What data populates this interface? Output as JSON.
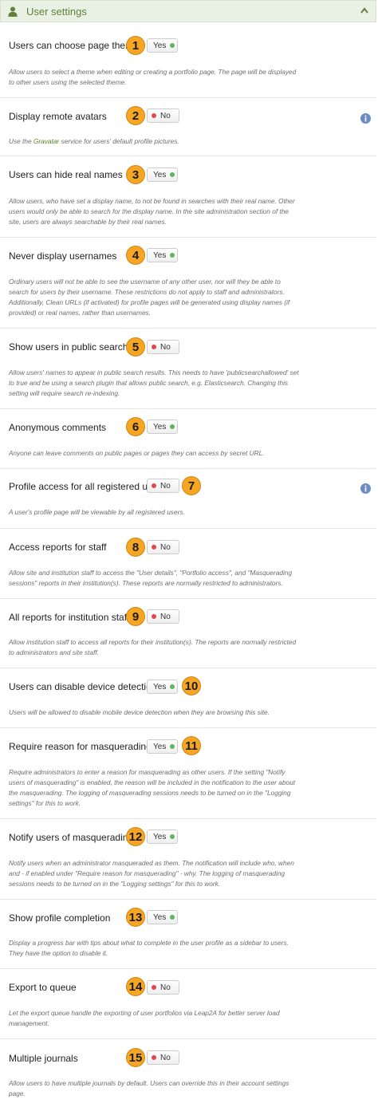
{
  "panel": {
    "title": "User settings",
    "icon": "user-icon",
    "collapse_icon": "chevron-up-icon",
    "colors": {
      "header_bg": "#e9f0e4",
      "title": "#62803a",
      "badge": "#f6a623",
      "on_dot": "#5fb55f",
      "off_dot": "#e2474f",
      "info": "#6d8cc5"
    }
  },
  "settings": [
    {
      "label": "Users can choose page themes",
      "value": "Yes",
      "badge": "1",
      "desc": [
        "Allow users to select a theme when editing or creating a portfolio page. The page will be displayed",
        "to other users using the selected theme."
      ]
    },
    {
      "label": "Display remote avatars",
      "value": "No",
      "badge": "2",
      "info_icon": "info-icon",
      "desc_before": "Use the ",
      "desc_link": "Gravatar",
      "desc_after": " service for users' default profile pictures."
    },
    {
      "label": "Users can hide real names",
      "value": "Yes",
      "badge": "3",
      "desc": [
        "Allow users, who have set a display name, to not be found in searches with their real name. Other",
        "users would only be able to search for the display name. In the site administration section of the",
        "site, users are always searchable by their real names."
      ]
    },
    {
      "label": "Never display usernames",
      "value": "Yes",
      "badge": "4",
      "desc": [
        "Ordinary users will not be able to see the username of any other user, nor will they be able to",
        "search for users by their username. These restrictions do not apply to staff and administrators.",
        "Additionally, Clean URLs (if activated) for profile pages will be generated using display names (if",
        "provided) or real names, rather than usernames."
      ]
    },
    {
      "label": "Show users in public search",
      "value": "No",
      "badge": "5",
      "desc": [
        "Allow users' names to appear in public search results. This needs to have 'publicsearchallowed' set",
        "to true and be using a search plugin that allows public search, e.g. Elasticsearch. Changing this",
        "setting will require search re-indexing."
      ]
    },
    {
      "label": "Anonymous comments",
      "value": "Yes",
      "badge": "6",
      "desc": [
        "Anyone can leave comments on public pages or pages they can access by secret URL."
      ]
    },
    {
      "label": "Profile access for all registered users",
      "value": "No",
      "badge": "7",
      "info_icon": "info-icon",
      "desc": [
        "A user's profile page will be viewable by all registered users."
      ]
    },
    {
      "label": "Access reports for staff",
      "value": "No",
      "badge": "8",
      "desc": [
        "Allow site and institution staff to access the \"User details\", \"Portfolio access\", and \"Masquerading",
        "sessions\" reports in their institution(s). These reports are normally restricted to administrators."
      ]
    },
    {
      "label": "All reports for institution staff",
      "value": "No",
      "badge": "9",
      "desc": [
        "Allow institution staff to access all reports for their institution(s). The reports are normally restricted",
        "to administrators and site staff."
      ]
    },
    {
      "label": "Users can disable device detection",
      "value": "Yes",
      "badge": "10",
      "desc": [
        "Users will be allowed to disable mobile device detection when they are browsing this site."
      ]
    },
    {
      "label": "Require reason for masquerading",
      "value": "Yes",
      "badge": "11",
      "desc": [
        "Require administrators to enter a reason for masquerading as other users. If the setting \"Notify",
        "users of masquerading\" is enabled, the reason will be included in the notification to the user about",
        "the masquerading. The logging of masquerading sessions needs to be turned on in the \"Logging",
        "settings\" for this to work."
      ]
    },
    {
      "label": "Notify users of masquerading",
      "value": "Yes",
      "badge": "12",
      "desc": [
        "Notify users when an administrator masqueraded as them. The notification will include who, when",
        "and - if enabled under \"Require reason for masquerading\" - why. The logging of masquerading",
        "sessions needs to be turned on in the \"Logging settings\" for this to work."
      ]
    },
    {
      "label": "Show profile completion",
      "value": "Yes",
      "badge": "13",
      "desc": [
        "Display a progress bar with tips about what to complete in the user profile as a sidebar to users.",
        "They have the option to disable it."
      ]
    },
    {
      "label": "Export to queue",
      "value": "No",
      "badge": "14",
      "desc": [
        "Let the export queue handle the exporting of user portfolios via Leap2A for better server load",
        "management."
      ]
    },
    {
      "label": "Multiple journals",
      "value": "No",
      "badge": "15",
      "desc": [
        "Allow users to have multiple journals by default. Users can override this in their account settings",
        "page."
      ]
    }
  ]
}
